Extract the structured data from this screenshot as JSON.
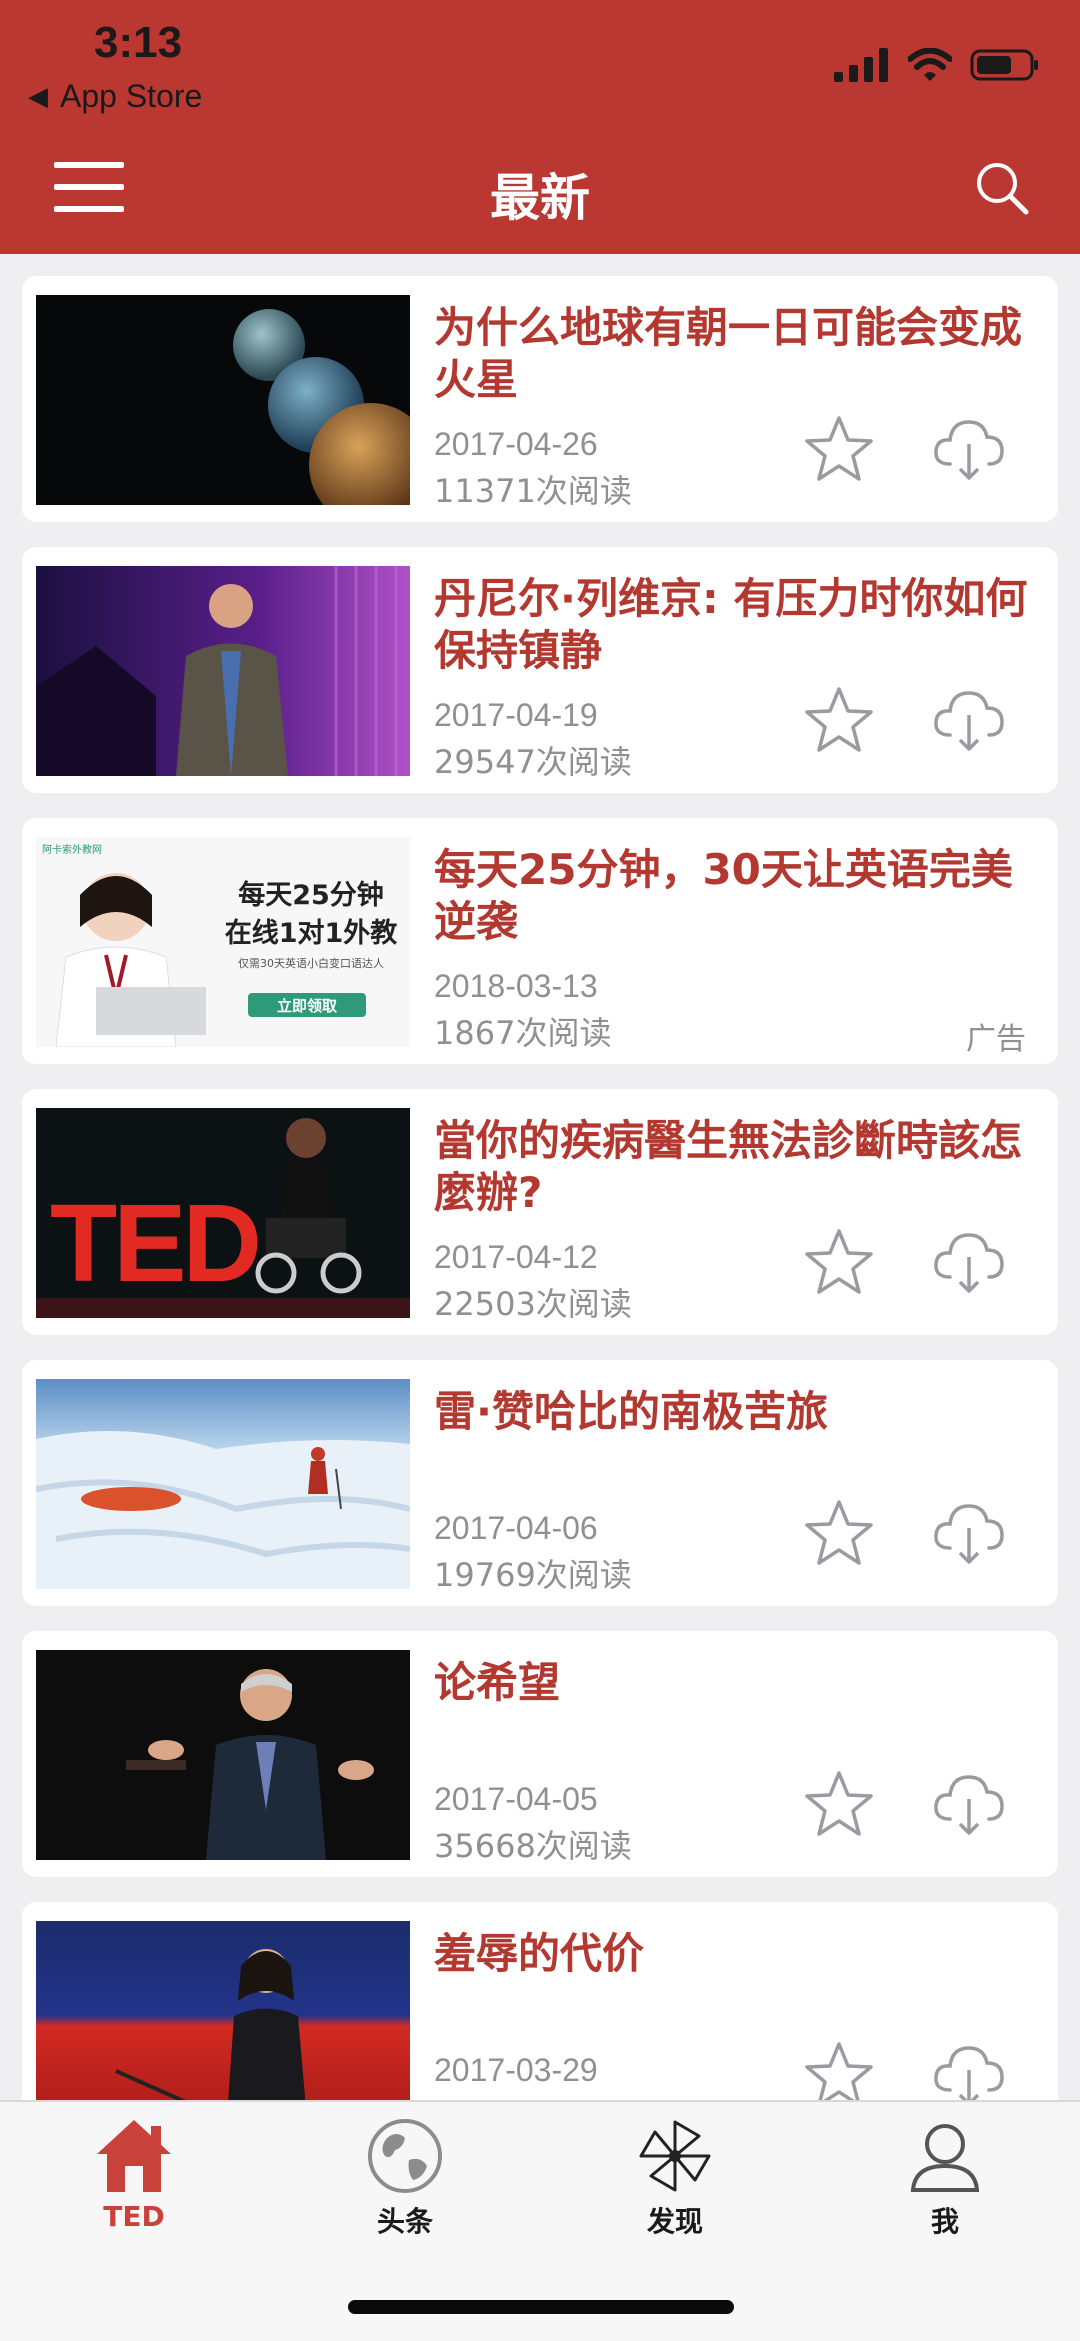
{
  "status": {
    "time": "3:13",
    "back_app": "App Store"
  },
  "nav": {
    "title": "最新"
  },
  "articles": [
    {
      "title": "为什么地球有朝一日可能会变成火星",
      "date": "2017-04-26",
      "reads": "11371次阅读"
    },
    {
      "title": "丹尼尔·列维京: 有压力时你如何保持镇静",
      "date": "2017-04-19",
      "reads": "29547次阅读"
    },
    {
      "title": "每天25分钟，30天让英语完美逆袭",
      "date": "2018-03-13",
      "reads": "1867次阅读",
      "ad": "广告",
      "ad_banner": {
        "line1": "每天25分钟",
        "line2": "在线1对1外教",
        "sub": "仅需30天英语小白变口语达人",
        "cta": "立即领取",
        "brand": "阿卡索外教网"
      }
    },
    {
      "title": "當你的疾病醫生無法診斷時該怎麼辦?",
      "date": "2017-04-12",
      "reads": "22503次阅读",
      "thumb_text": "TED"
    },
    {
      "title": "雷·赞哈比的南极苦旅",
      "date": "2017-04-06",
      "reads": "19769次阅读"
    },
    {
      "title": "论希望",
      "date": "2017-04-05",
      "reads": "35668次阅读"
    },
    {
      "title": "羞辱的代价",
      "date": "2017-03-29",
      "reads": ""
    }
  ],
  "tabs": [
    {
      "label": "TED",
      "icon": "house-icon",
      "active": true
    },
    {
      "label": "头条",
      "icon": "globe-icon",
      "active": false
    },
    {
      "label": "发现",
      "icon": "pinwheel-icon",
      "active": false
    },
    {
      "label": "我",
      "icon": "user-icon",
      "active": false
    }
  ],
  "colors": {
    "brand_red": "#bb3832",
    "title_red": "#b23830",
    "meta_gray": "#8f8f94",
    "background": "#efeff2"
  }
}
